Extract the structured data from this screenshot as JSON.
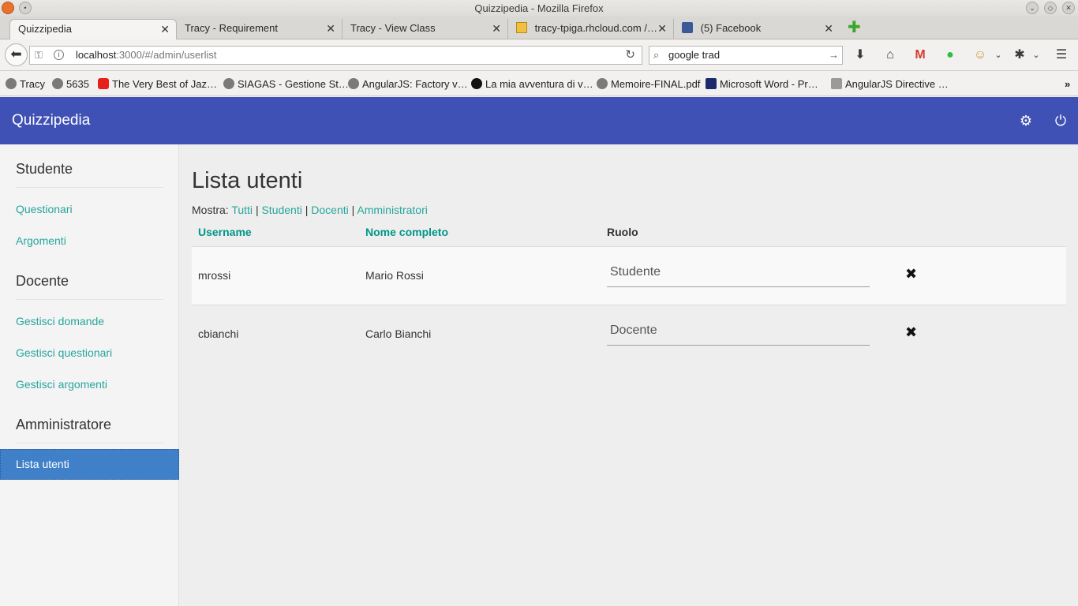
{
  "window": {
    "title": "Quizzipedia - Mozilla Firefox"
  },
  "tabs": [
    {
      "label": "Quizzipedia",
      "active": true
    },
    {
      "label": "Tracy - Requirement",
      "active": false
    },
    {
      "label": "Tracy - View Class",
      "active": false
    },
    {
      "label": "tracy-tpiga.rhcloud.com /…",
      "active": false
    },
    {
      "label": "(5) Facebook",
      "active": false
    }
  ],
  "navbar": {
    "url_host": "localhost",
    "url_rest": ":3000/#/admin/userlist",
    "search_value": "google trad"
  },
  "bookmarks": [
    {
      "label": "Tracy",
      "icon": "globe-icon"
    },
    {
      "label": "5635",
      "icon": "globe-icon"
    },
    {
      "label": "The Very Best of Jaz…",
      "icon": "youtube-icon"
    },
    {
      "label": "SIAGAS - Gestione St…",
      "icon": "globe-icon"
    },
    {
      "label": "AngularJS: Factory v…",
      "icon": "globe-icon"
    },
    {
      "label": "La mia avventura di v…",
      "icon": "g-icon"
    },
    {
      "label": "Memoire-FINAL.pdf",
      "icon": "globe-icon"
    },
    {
      "label": "Microsoft Word - Pr…",
      "icon": "shield-icon"
    },
    {
      "label": "AngularJS Directive …",
      "icon": "document-icon"
    }
  ],
  "app": {
    "brand": "Quizzipedia",
    "accent": "#3f51b5",
    "link_color": "#26a69a"
  },
  "sidebar": {
    "sections": [
      {
        "title": "Studente",
        "items": [
          "Questionari",
          "Argomenti"
        ]
      },
      {
        "title": "Docente",
        "items": [
          "Gestisci domande",
          "Gestisci questionari",
          "Gestisci argomenti"
        ]
      },
      {
        "title": "Amministratore",
        "items": [
          "Lista utenti"
        ]
      }
    ],
    "active_item": "Lista utenti"
  },
  "main": {
    "title": "Lista utenti",
    "filter_label": "Mostra:",
    "filters": [
      "Tutti",
      "Studenti",
      "Docenti",
      "Amministratori"
    ],
    "columns": {
      "username": "Username",
      "fullname": "Nome completo",
      "role": "Ruolo"
    },
    "rows": [
      {
        "username": "mrossi",
        "fullname": "Mario Rossi",
        "role": "Studente"
      },
      {
        "username": "cbianchi",
        "fullname": "Carlo Bianchi",
        "role": "Docente"
      }
    ]
  }
}
